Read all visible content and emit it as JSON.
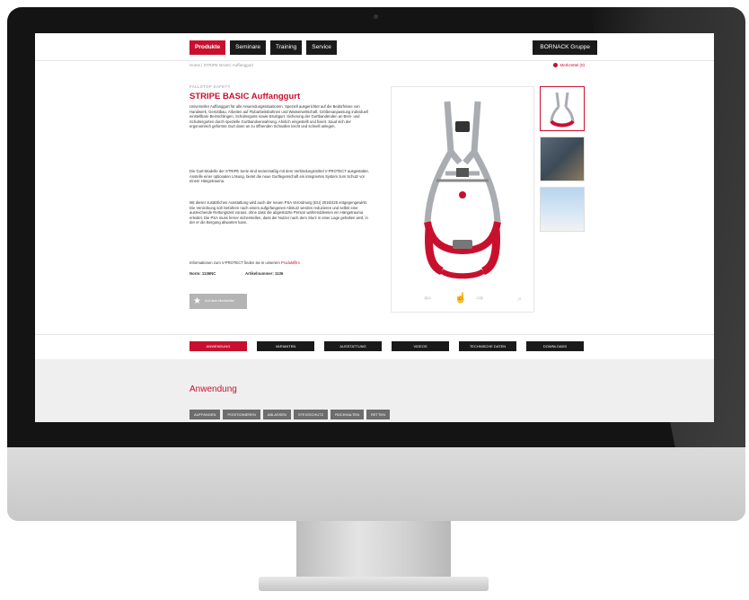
{
  "nav": {
    "items": [
      "Produkte",
      "Seminare",
      "Training",
      "Service"
    ],
    "group": "BORNACK Gruppe"
  },
  "breadcrumb": "Home | STRIPE BASIC Auffanggurt",
  "wishlist_link": "Merkzettel (0)",
  "product": {
    "brand": "FALLSTOP SAFETY",
    "title": "STRIPE BASIC Auffanggurt",
    "paragraph1": "Universeller Auffanggurt für alle Anwendungssituationen. Speziell ausgerichtet auf die Bedürfnisse von Handwerk, Gerüstbau, Arbeiten auf Flubarbeitsbühnen und Wasserwirtschaft. Größenanpassung individuell einstellbare Beinschlingen, Schultergurte sowie Brustgurt. Sicherung der Gurtbandenden an Bein- und Schultergurten durch spezielle Gurtbandverwahrung. Ahnlich eingestellt und fixiert. Saud sich der ergonomisch geformte Gurt dann an zu öffnenden Schnallen leicht und schnell anlegen.",
    "paragraph2": "Die Gurt-Modelle der STRIPE Serie sind serienmäßig mit dem Verbindungsmittel V-PROTECT ausgestattet. Anstelle einer optionalen Lösung, bietet die neue Gurtlegenschaft ein integriertes System zum Schutz vor einem Hängetrauma.",
    "paragraph3": "Mit dieser zusätzlichen Ausstattung wird auch der neuen PSA Verordnung (EU) 2016/425 entgegengewirkt. Die Verordnung soll Gefahren nach einem aufgefangenen Absturz werden reduzieren und selbst eine ausreichende Rettungszeit voraus, ohne dass die abgestürzte Person währenddessen ein Hängetrauma erleidet. Die PSA muss ferner sicherstellen, dass der Nutzer nach dem Sturz in einer Lage gehalten wird, in der er die Bergung abwarten kann.",
    "paragraph4_prefix": "Informationen zum V-PROTECT finden sie in unserem",
    "paragraph4_link": "Produktfilm",
    "norm": "Norm: 1136NC",
    "article": "Artikelnummer: 1136",
    "wishlist_button": "Auf dem Merkzettel"
  },
  "tabs": [
    "ANWENDUNG",
    "VARIANTEN",
    "AUSSTATTUNG",
    "VIDEOS",
    "TECHNISCHE DATEN",
    "DOWNLOADS"
  ],
  "section": {
    "title": "Anwendung",
    "subtabs": [
      "AUFFANGEN",
      "POSITIONIEREN",
      "ABLASSEN",
      "STEIGSCHUTZ",
      "RÜCKHALTEN",
      "RETTEN"
    ]
  },
  "colors": {
    "brand_red": "#c8102e",
    "dark": "#1a1a1a",
    "harness_grey": "#a9acb0",
    "harness_red": "#c8102e"
  }
}
